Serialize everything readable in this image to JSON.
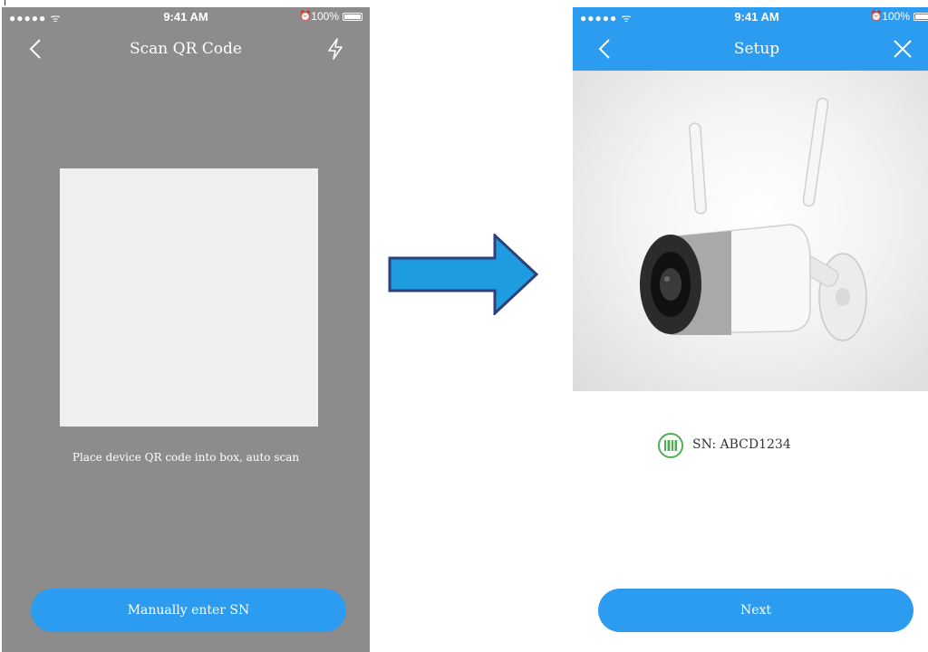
{
  "colors": {
    "accent": "#2b9cf0",
    "scan_background": "#8c8c8c",
    "scan_box": "#efefef",
    "sn_icon": "#4caf50",
    "arrow_fill": "#1f9be0",
    "arrow_stroke": "#2f3f7a"
  },
  "status_bar": {
    "signal": "●●●●● ᯤ",
    "time": "9:41 AM",
    "battery": "100%"
  },
  "scan_screen": {
    "title": "Scan QR Code",
    "back_icon": "chevron-left-icon",
    "flash_icon": "lightning-icon",
    "hint": "Place device QR code into box, auto scan",
    "manual_button": "Manually enter SN"
  },
  "flow_arrow_icon": "arrow-right-icon",
  "setup_screen": {
    "title": "Setup",
    "back_icon": "chevron-left-icon",
    "close_icon": "close-icon",
    "device_image": "outdoor-bullet-camera",
    "serial_icon": "barcode-icon",
    "serial": "SN: ABCD1234",
    "next_button": "Next"
  }
}
